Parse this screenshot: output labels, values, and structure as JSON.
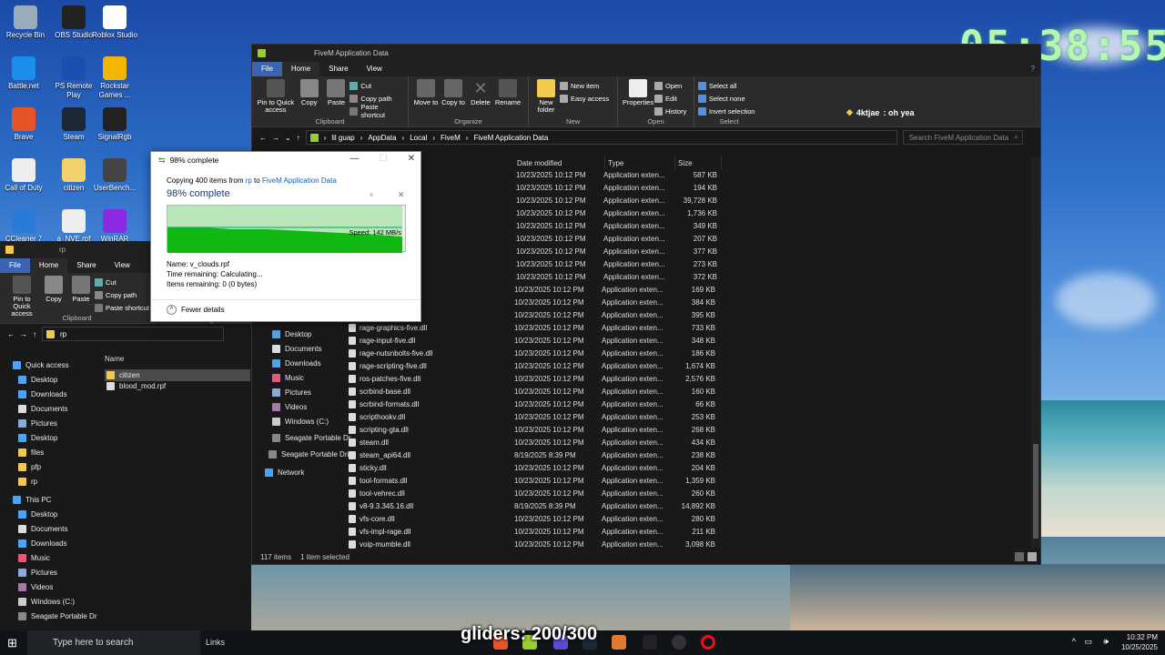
{
  "clock": "05:38:55",
  "desktop_icons": [
    {
      "label": "Recycle Bin",
      "icon": "recycle-bin-icon",
      "color": "#9ab"
    },
    {
      "label": "OBS Studio",
      "icon": "obs-icon",
      "color": "#222"
    },
    {
      "label": "Roblox Studio",
      "icon": "roblox-icon",
      "color": "#fff"
    },
    {
      "label": "Battle.net",
      "icon": "battlenet-icon",
      "color": "#1b8eea"
    },
    {
      "label": "PS Remote Play",
      "icon": "ps-remote-icon",
      "color": "#1d4fb0"
    },
    {
      "label": "Rockstar Games ...",
      "icon": "rockstar-icon",
      "color": "#f2b600"
    },
    {
      "label": "Brave",
      "icon": "brave-icon",
      "color": "#e8542a"
    },
    {
      "label": "Steam",
      "icon": "steam-icon",
      "color": "#1b2838"
    },
    {
      "label": "SignalRgb",
      "icon": "signalrgb-icon",
      "color": "#222"
    },
    {
      "label": "Call of Duty",
      "icon": "file-icon",
      "color": "#eee"
    },
    {
      "label": "citizen",
      "icon": "folder-icon",
      "color": "#f2d06a"
    },
    {
      "label": "UserBench...",
      "icon": "gauge-icon",
      "color": "#444"
    },
    {
      "label": "CCleaner 7",
      "icon": "ccleaner-icon",
      "color": "#2a7bd8"
    },
    {
      "label": "a_NVE.rpf",
      "icon": "file-icon",
      "color": "#eee"
    },
    {
      "label": "WinRAR",
      "icon": "winrar-icon",
      "color": "#8a2be2"
    }
  ],
  "explorer_main": {
    "title": "FiveM Application Data",
    "tabs": [
      "File",
      "Home",
      "Share",
      "View"
    ],
    "ribbon": {
      "clipboard": {
        "pin": "Pin to Quick access",
        "copy": "Copy",
        "paste": "Paste",
        "cut": "Cut",
        "copy_path": "Copy path",
        "paste_shortcut": "Paste shortcut",
        "group": "Clipboard"
      },
      "organize": {
        "move_to": "Move to",
        "copy_to": "Copy to",
        "delete": "Delete",
        "rename": "Rename",
        "group": "Organize"
      },
      "new": {
        "new_folder": "New folder",
        "new_item": "New item",
        "easy_access": "Easy access",
        "group": "New"
      },
      "open": {
        "properties": "Properties",
        "open": "Open",
        "edit": "Edit",
        "history": "History",
        "group": "Open"
      },
      "select": {
        "select_all": "Select all",
        "select_none": "Select none",
        "invert": "Invert selection",
        "group": "Select"
      }
    },
    "breadcrumb": [
      "lil guap",
      "AppData",
      "Local",
      "FiveM",
      "FiveM Application Data"
    ],
    "search_placeholder": "Search FiveM Application Data",
    "columns": {
      "date": "Date modified",
      "type": "Type",
      "size": "Size"
    },
    "files": [
      {
        "name": "",
        "date": "10/23/2025 10:12 PM",
        "type": "Application exten...",
        "size": "587 KB"
      },
      {
        "name": "",
        "date": "10/23/2025 10:12 PM",
        "type": "Application exten...",
        "size": "194 KB"
      },
      {
        "name": "",
        "date": "10/23/2025 10:12 PM",
        "type": "Application exten...",
        "size": "39,728 KB"
      },
      {
        "name": "",
        "date": "10/23/2025 10:12 PM",
        "type": "Application exten...",
        "size": "1,736 KB"
      },
      {
        "name": "",
        "date": "10/23/2025 10:12 PM",
        "type": "Application exten...",
        "size": "349 KB"
      },
      {
        "name": "",
        "date": "10/23/2025 10:12 PM",
        "type": "Application exten...",
        "size": "207 KB"
      },
      {
        "name": "",
        "date": "10/23/2025 10:12 PM",
        "type": "Application exten...",
        "size": "377 KB"
      },
      {
        "name": "",
        "date": "10/23/2025 10:12 PM",
        "type": "Application exten...",
        "size": "273 KB"
      },
      {
        "name": "",
        "date": "10/23/2025 10:12 PM",
        "type": "Application exten...",
        "size": "372 KB"
      },
      {
        "name": "ve.dll",
        "date": "10/23/2025 10:12 PM",
        "type": "Application exten...",
        "size": "169 KB"
      },
      {
        "name": ".dll",
        "date": "10/23/2025 10:12 PM",
        "type": "Application exten...",
        "size": "384 KB"
      },
      {
        "name": ".dll",
        "date": "10/23/2025 10:12 PM",
        "type": "Application exten...",
        "size": "395 KB"
      },
      {
        "name": "rage-graphics-five.dll",
        "date": "10/23/2025 10:12 PM",
        "type": "Application exten...",
        "size": "733 KB"
      },
      {
        "name": "rage-input-five.dll",
        "date": "10/23/2025 10:12 PM",
        "type": "Application exten...",
        "size": "348 KB"
      },
      {
        "name": "rage-nutsnbolts-five.dll",
        "date": "10/23/2025 10:12 PM",
        "type": "Application exten...",
        "size": "186 KB"
      },
      {
        "name": "rage-scripting-five.dll",
        "date": "10/23/2025 10:12 PM",
        "type": "Application exten...",
        "size": "1,674 KB"
      },
      {
        "name": "ros-patches-five.dll",
        "date": "10/23/2025 10:12 PM",
        "type": "Application exten...",
        "size": "2,576 KB"
      },
      {
        "name": "scrbind-base.dll",
        "date": "10/23/2025 10:12 PM",
        "type": "Application exten...",
        "size": "160 KB"
      },
      {
        "name": "scrbind-formats.dll",
        "date": "10/23/2025 10:12 PM",
        "type": "Application exten...",
        "size": "66 KB"
      },
      {
        "name": "scripthookv.dll",
        "date": "10/23/2025 10:12 PM",
        "type": "Application exten...",
        "size": "253 KB"
      },
      {
        "name": "scripting-gta.dll",
        "date": "10/23/2025 10:12 PM",
        "type": "Application exten...",
        "size": "268 KB"
      },
      {
        "name": "steam.dll",
        "date": "10/23/2025 10:12 PM",
        "type": "Application exten...",
        "size": "434 KB"
      },
      {
        "name": "steam_api64.dll",
        "date": "8/19/2025 8:39 PM",
        "type": "Application exten...",
        "size": "238 KB"
      },
      {
        "name": "sticky.dll",
        "date": "10/23/2025 10:12 PM",
        "type": "Application exten...",
        "size": "204 KB"
      },
      {
        "name": "tool-formats.dll",
        "date": "10/23/2025 10:12 PM",
        "type": "Application exten...",
        "size": "1,359 KB"
      },
      {
        "name": "tool-vehrec.dll",
        "date": "10/23/2025 10:12 PM",
        "type": "Application exten...",
        "size": "260 KB"
      },
      {
        "name": "v8-9.3.345.16.dll",
        "date": "8/19/2025 8:39 PM",
        "type": "Application exten...",
        "size": "14,892 KB"
      },
      {
        "name": "vfs-core.dll",
        "date": "10/23/2025 10:12 PM",
        "type": "Application exten...",
        "size": "280 KB"
      },
      {
        "name": "vfs-impl-rage.dll",
        "date": "10/23/2025 10:12 PM",
        "type": "Application exten...",
        "size": "211 KB"
      },
      {
        "name": "voip-mumble.dll",
        "date": "10/23/2025 10:12 PM",
        "type": "Application exten...",
        "size": "3,098 KB"
      }
    ],
    "nav": [
      "Desktop",
      "Documents",
      "Downloads",
      "Music",
      "Pictures",
      "Videos",
      "Windows (C:)",
      "Seagate Portable Dr",
      "Seagate Portable Driv",
      "Network"
    ],
    "status": {
      "items": "117 items",
      "selected": "1 item selected"
    }
  },
  "explorer_back": {
    "title": "rp",
    "tabs": [
      "File",
      "Home",
      "Share",
      "View"
    ],
    "pin": "Pin to Quick access",
    "copy": "Copy",
    "paste": "Paste",
    "cut": "Cut",
    "copy_path": "Copy path",
    "paste_shortcut": "Paste shortcut",
    "clipboard": "Clipboard",
    "organize": "Organize",
    "path": "rp",
    "column_name": "Name",
    "files": [
      "citizen",
      "blood_mod.rpf"
    ],
    "quick_access": "Quick access",
    "nav": [
      "Desktop",
      "Downloads",
      "Documents",
      "Pictures",
      "Desktop",
      "files",
      "pfp",
      "rp"
    ],
    "this_pc": "This PC",
    "pc_nav": [
      "Desktop",
      "Documents",
      "Downloads",
      "Music",
      "Pictures",
      "Videos",
      "Windows (C:)",
      "Seagate Portable Dr"
    ]
  },
  "copy_dialog": {
    "title": "98% complete",
    "line_prefix": "Copying 400 items from ",
    "from": "rp",
    "to_word": " to ",
    "to": "FiveM Application Data",
    "heading": "98% complete",
    "speed": "Speed: 142 MB/s",
    "progress": 0.98,
    "name_label": "Name:",
    "name_value": "v_clouds.rpf",
    "time_label": "Time remaining:",
    "time_value": "Calculating...",
    "items_label": "Items remaining:",
    "items_value": "0 (0 bytes)",
    "fewer_details": "Fewer details"
  },
  "chat": {
    "user": "4ktjae",
    "message": " : oh yea"
  },
  "overlay_text": "gliders: 200/300",
  "taskbar": {
    "search_placeholder": "Type here to search",
    "links": "Links",
    "time": "10:32 PM",
    "date": "10/25/2025"
  }
}
